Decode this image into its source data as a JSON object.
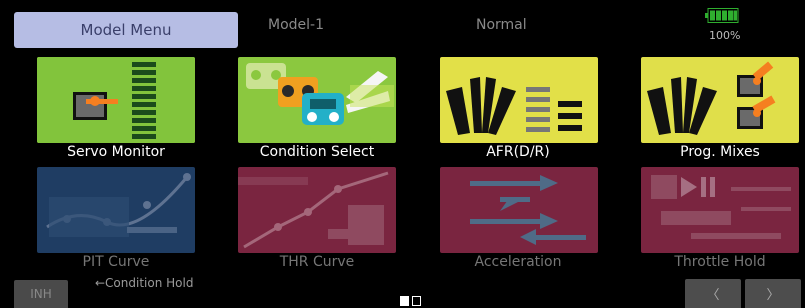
{
  "header": {
    "menu_tab_label": "Model Menu",
    "model_name": "Model-1",
    "condition_name": "Normal",
    "battery_percent_label": "100%",
    "battery_level": 1.0
  },
  "tiles": [
    {
      "label": "Servo Monitor",
      "enabled": true
    },
    {
      "label": "Condition Select",
      "enabled": true
    },
    {
      "label": "AFR(D/R)",
      "enabled": true
    },
    {
      "label": "Prog. Mixes",
      "enabled": true
    },
    {
      "label": "PIT Curve",
      "enabled": false
    },
    {
      "label": "THR Curve",
      "enabled": false
    },
    {
      "label": "Acceleration",
      "enabled": false
    },
    {
      "label": "Throttle Hold",
      "enabled": false
    }
  ],
  "footer": {
    "inh_label": "INH",
    "hint_text": "←Condition Hold",
    "prev_label": "〈",
    "next_label": "〉",
    "page_current": 1,
    "page_total": 2
  },
  "colors": {
    "tile_green": "#7ec23a",
    "tile_yellow": "#e3e24a",
    "tile_blue_dim": "#1f3d63",
    "tile_red_dim": "#7a2540",
    "menu_tab_bg": "#b6bde4"
  }
}
